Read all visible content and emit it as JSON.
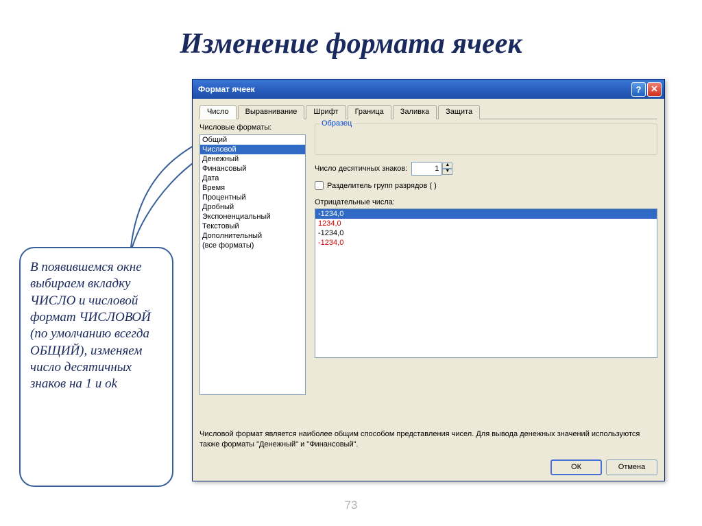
{
  "slide": {
    "title": "Изменение формата ячеек",
    "number": "73"
  },
  "dialog": {
    "title": "Формат ячеек",
    "tabs": [
      "Число",
      "Выравнивание",
      "Шрифт",
      "Граница",
      "Заливка",
      "Защита"
    ],
    "active_tab": 0,
    "formats_label": "Числовые форматы:",
    "formats": [
      "Общий",
      "Числовой",
      "Денежный",
      "Финансовый",
      "Дата",
      "Время",
      "Процентный",
      "Дробный",
      "Экспоненциальный",
      "Текстовый",
      "Дополнительный",
      "(все форматы)"
    ],
    "selected_format_index": 1,
    "sample_label": "Образец",
    "decimal_label": "Число десятичных знаков:",
    "decimal_value": "1",
    "separator_label": "Разделитель групп разрядов ( )",
    "negative_label": "Отрицательные числа:",
    "negative_items": [
      {
        "text": "-1234,0",
        "red": false,
        "selected": true
      },
      {
        "text": "1234,0",
        "red": true,
        "selected": false
      },
      {
        "text": "-1234,0",
        "red": false,
        "selected": false
      },
      {
        "text": "-1234,0",
        "red": true,
        "selected": false
      }
    ],
    "description": "Числовой формат является наиболее общим способом представления чисел. Для вывода денежных значений используются также форматы \"Денежный\" и \"Финансовый\".",
    "ok": "ОК",
    "cancel": "Отмена"
  },
  "callout": {
    "text": "В появившемся окне выбираем вкладку  ЧИСЛО и числовой формат ЧИСЛОВОЙ (по умолчанию всегда ОБЩИЙ), изменяем число десятичных знаков на 1 и ok"
  }
}
